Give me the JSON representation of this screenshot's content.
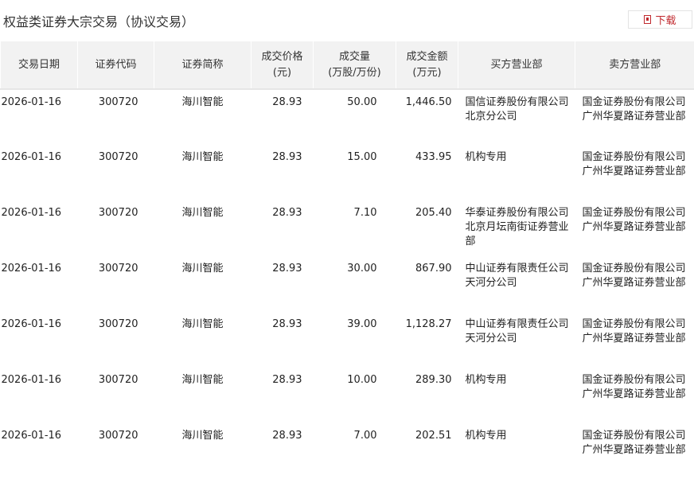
{
  "title": "权益类证券大宗交易（协议交易）",
  "download_label": "下载",
  "headers": [
    "交易日期",
    "证券代码",
    "证券简称",
    "成交价格\n(元)",
    "成交量\n(万股/万份)",
    "成交金额\n(万元)",
    "买方营业部",
    "卖方营业部"
  ],
  "rows": [
    [
      "2026-01-16",
      "300720",
      "海川智能",
      "28.93",
      "50.00",
      "1,446.50",
      "国信证券股份有限公司北京分公司",
      "国金证券股份有限公司广州华夏路证券营业部"
    ],
    [
      "2026-01-16",
      "300720",
      "海川智能",
      "28.93",
      "15.00",
      "433.95",
      "机构专用",
      "国金证券股份有限公司广州华夏路证券营业部"
    ],
    [
      "2026-01-16",
      "300720",
      "海川智能",
      "28.93",
      "7.10",
      "205.40",
      "华泰证券股份有限公司北京月坛南街证券营业部",
      "国金证券股份有限公司广州华夏路证券营业部"
    ],
    [
      "2026-01-16",
      "300720",
      "海川智能",
      "28.93",
      "30.00",
      "867.90",
      "中山证券有限责任公司天河分公司",
      "国金证券股份有限公司广州华夏路证券营业部"
    ],
    [
      "2026-01-16",
      "300720",
      "海川智能",
      "28.93",
      "39.00",
      "1,128.27",
      "中山证券有限责任公司天河分公司",
      "国金证券股份有限公司广州华夏路证券营业部"
    ],
    [
      "2026-01-16",
      "300720",
      "海川智能",
      "28.93",
      "10.00",
      "289.30",
      "机构专用",
      "国金证券股份有限公司广州华夏路证券营业部"
    ],
    [
      "2026-01-16",
      "300720",
      "海川智能",
      "28.93",
      "7.00",
      "202.51",
      "机构专用",
      "国金证券股份有限公司广州华夏路证券营业部"
    ]
  ]
}
